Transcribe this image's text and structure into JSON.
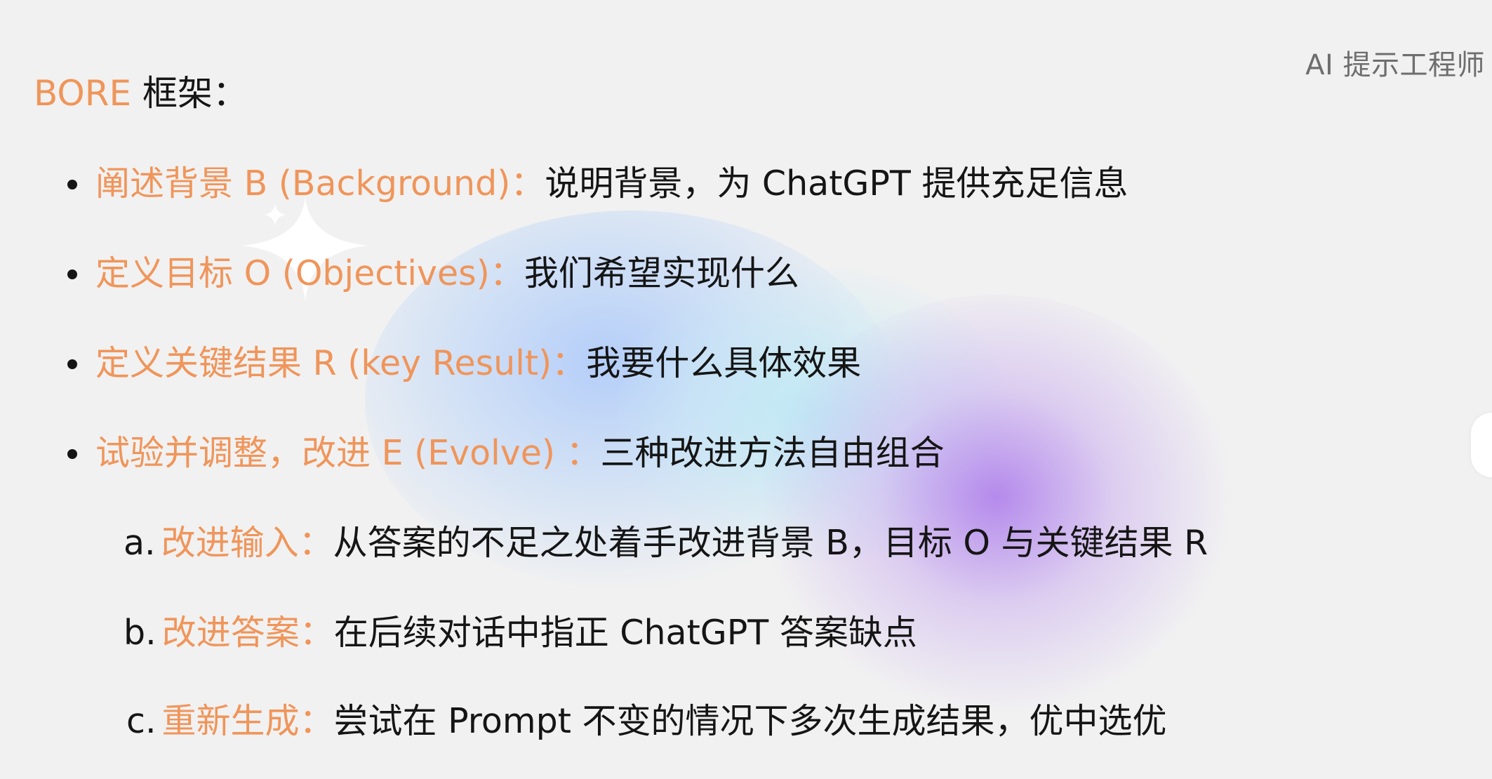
{
  "header": {
    "corner_label": "AI 提示工程师"
  },
  "title": {
    "accent": "BORE",
    "rest": " 框架："
  },
  "bullets": [
    {
      "label": "阐述背景 B (Background)：",
      "text": "说明背景，为 ChatGPT 提供充足信息"
    },
    {
      "label": "定义目标 O (Objectives)：",
      "text": "我们希望实现什么"
    },
    {
      "label": "定义关键结果 R (key Result)：",
      "text": "我要什么具体效果"
    },
    {
      "label": "试验并调整，改进 E (Evolve) ：",
      "text": "三种改进方法自由组合"
    }
  ],
  "sub_items": [
    {
      "marker": "a.",
      "label": "改进输入：",
      "text": "从答案的不足之处着手改进背景 B，目标 O 与关键结果 R"
    },
    {
      "marker": "b.",
      "label": "改进答案：",
      "text": "在后续对话中指正 ChatGPT 答案缺点"
    },
    {
      "marker": "c.",
      "label": "重新生成：",
      "text": "尝试在 Prompt 不变的情况下多次生成结果，优中选优"
    }
  ],
  "colors": {
    "accent": "#f0955a",
    "text": "#151515",
    "background": "#f1f1f1",
    "muted": "#6e6e6e"
  }
}
